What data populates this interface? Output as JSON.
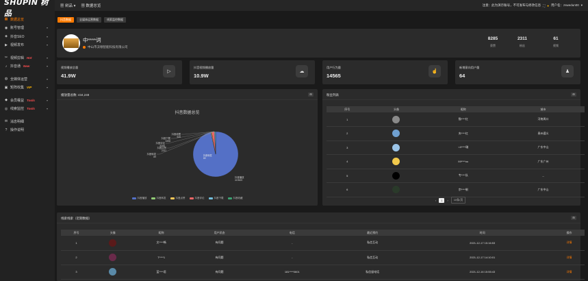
{
  "brand": {
    "logo_text": "SHUPIN 树品"
  },
  "sidebar": {
    "items": [
      {
        "label": "数据总览",
        "icon": "dashboard-icon",
        "active": true,
        "chev": false,
        "tag": ""
      },
      {
        "label": "账号管理",
        "icon": "user-icon",
        "chev": true,
        "tag": ""
      },
      {
        "label": "抖音SEO",
        "icon": "seo-icon",
        "chev": true,
        "tag": ""
      },
      {
        "label": "视频发布",
        "icon": "video-icon",
        "chev": true,
        "tag": ""
      },
      {
        "label": "视频剪辑",
        "icon": "scissors-icon",
        "chev": true,
        "tag": "Hot",
        "gap": true
      },
      {
        "label": "抖音通",
        "icon": "douyin-icon",
        "chev": true,
        "tag": "New"
      },
      {
        "label": "全媒体运营",
        "icon": "media-icon",
        "chev": true,
        "tag": "",
        "gap": true
      },
      {
        "label": "矩阵收集",
        "icon": "matrix-icon",
        "chev": true,
        "tag": "VIP"
      },
      {
        "label": "会员權益",
        "icon": "member-icon",
        "chev": true,
        "tag": "Tools",
        "gap": true
      },
      {
        "label": "线索监控",
        "icon": "monitor-icon",
        "chev": true,
        "tag": "Tools"
      },
      {
        "label": "消息明细",
        "icon": "message-icon",
        "chev": false,
        "tag": "",
        "gap": true
      },
      {
        "label": "操作说明",
        "icon": "help-icon",
        "chev": false,
        "tag": ""
      }
    ]
  },
  "topbar": {
    "menu": "树品",
    "breadcrumb": "数据总览",
    "notice": "注意：此为演示账号，不可发布与修改信息",
    "user": "用户名：zswedun00"
  },
  "tabs": [
    "抖音数据",
    "全媒体运营数据",
    "线索监控数据"
  ],
  "profile": {
    "name": "中****词",
    "company": "中山市沃顿智能科技有限公司",
    "stats": [
      {
        "value": "8285",
        "label": "获赞"
      },
      {
        "value": "2311",
        "label": "粉丝"
      },
      {
        "value": "61",
        "label": "视频"
      }
    ]
  },
  "cards": [
    {
      "title": "视频播放总量",
      "value": "41.9W",
      "icon": "play-icon"
    },
    {
      "title": "抖音视频播放量",
      "value": "10.9W",
      "icon": "cloud-icon"
    },
    {
      "title": "用户行为量",
      "value": "14565",
      "icon": "hand-icon"
    },
    {
      "title": "新增意向用户量",
      "value": "64",
      "icon": "person-icon"
    }
  ],
  "chart_panel": {
    "title": "播放量总数: 434,248",
    "btn": "⊞",
    "chart_title": "抖音数据总览"
  },
  "chart_data": {
    "type": "pie",
    "title": "抖音数据总览",
    "slices": [
      {
        "name": "抖音播放",
        "value": 419620,
        "color": "#5470c6",
        "label": "抖音播放\n419620"
      },
      {
        "name": "抖音转发",
        "value": 89,
        "color": "#91cc75",
        "label": "抖音转发\n89"
      },
      {
        "name": "抖音点赞",
        "value": 2311,
        "color": "#fac858",
        "label": "抖音点赞\n2311"
      },
      {
        "name": "抖音评论",
        "value": 8285,
        "color": "#ee6666",
        "label": "抖音评论\n8285"
      },
      {
        "name": "抖音下载",
        "value": 3398,
        "color": "#73c0de",
        "label": "抖音下载\n3398"
      },
      {
        "name": "抖音收藏",
        "value": 545,
        "color": "#3ba272",
        "label": "抖音收藏\n545"
      }
    ],
    "legend_position": "bottom"
  },
  "fans_panel": {
    "title": "粉丝列表",
    "btn": "⊞",
    "headers": [
      "序号",
      "头像",
      "昵称",
      "城市"
    ],
    "rows": [
      {
        "no": "1",
        "avatar": "#8a8a8a",
        "nick": "猫****红",
        "city": "河南周口"
      },
      {
        "no": "2",
        "avatar": "#6fa0d0",
        "nick": "夹****红",
        "city": "贵州遵义"
      },
      {
        "no": "3",
        "avatar": "#9bc4e8",
        "nick": "<0****璐",
        "city": "广东中山"
      },
      {
        "no": "4",
        "avatar": "#f2c94c",
        "nick": "Mi****ou",
        "city": "广东广州"
      },
      {
        "no": "5",
        "avatar": "#000000",
        "nick": "专****队",
        "city": "--"
      },
      {
        "no": "6",
        "avatar": "#2a3a2a",
        "nick": "宗****制",
        "city": "广东中山"
      }
    ],
    "pager": {
      "page": "1",
      "size": "10条/页"
    }
  },
  "leads_panel": {
    "title": "线索线索（近期数据）",
    "btn": "⊞",
    "headers": [
      "序号",
      "头像",
      "昵称",
      "用户状态",
      "电话",
      "最近预约",
      "时间",
      "操作"
    ],
    "rows": [
      {
        "no": "1",
        "avatar": "#5a1a1a",
        "nick": "文****畅",
        "status": "有问题",
        "phone": "-",
        "recent": "私信互动",
        "time": "2021-12-17 15:16:53",
        "op": "详情"
      },
      {
        "no": "2",
        "avatar": "#6a2a4a",
        "nick": "T****1",
        "status": "有问题",
        "phone": "-",
        "recent": "私信互动",
        "time": "2021-12-17 14:10:01",
        "op": "详情"
      },
      {
        "no": "3",
        "avatar": "#5a8aa8",
        "nick": "蓝****君",
        "status": "有问题",
        "phone": "181****0601",
        "recent": "私信留电话",
        "time": "2021-12-16 15:55:43",
        "op": "详情"
      }
    ]
  }
}
